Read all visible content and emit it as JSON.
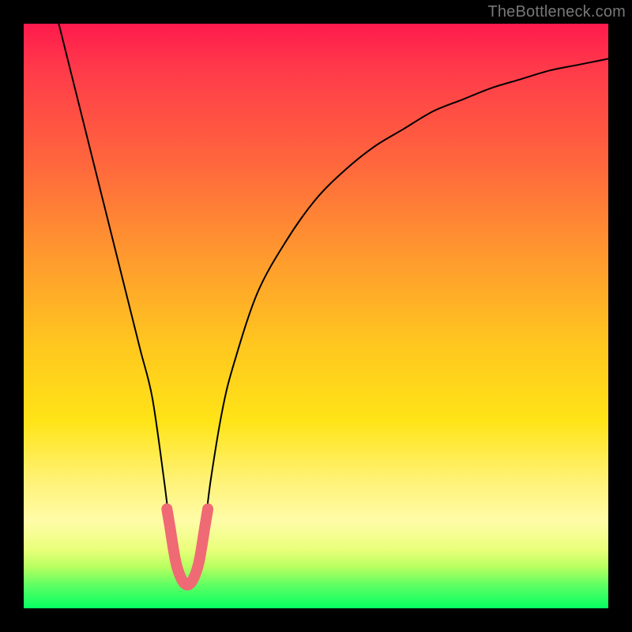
{
  "watermark": "TheBottleneck.com",
  "colors": {
    "background": "#000000",
    "gradient_top": "#ff1a4d",
    "gradient_mid": "#ffe417",
    "gradient_bottom": "#05ff62",
    "curve": "#000000",
    "valley_highlight": "#ef6a74"
  },
  "chart_data": {
    "type": "line",
    "title": "",
    "xlabel": "",
    "ylabel": "",
    "xlim": [
      0,
      100
    ],
    "ylim": [
      0,
      100
    ],
    "legend": false,
    "grid": false,
    "series": [
      {
        "name": "bottleneck-curve",
        "x": [
          6,
          8,
          10,
          12,
          14,
          16,
          18,
          20,
          22,
          24,
          25,
          26,
          27,
          28,
          29,
          30,
          31,
          32,
          34,
          36,
          40,
          45,
          50,
          55,
          60,
          65,
          70,
          75,
          80,
          85,
          90,
          95,
          100
        ],
        "y": [
          100,
          92,
          84,
          76,
          68,
          60,
          52,
          44,
          36,
          22,
          14,
          8,
          5,
          4,
          5,
          8,
          14,
          22,
          34,
          42,
          54,
          63,
          70,
          75,
          79,
          82,
          85,
          87,
          89,
          90.5,
          92,
          93,
          94
        ]
      },
      {
        "name": "valley-highlight",
        "x": [
          24.5,
          25,
          26,
          27,
          28,
          29,
          30,
          31,
          31.5
        ],
        "y": [
          17,
          14,
          8,
          5,
          4,
          5,
          8,
          14,
          17
        ]
      }
    ],
    "annotations": []
  }
}
